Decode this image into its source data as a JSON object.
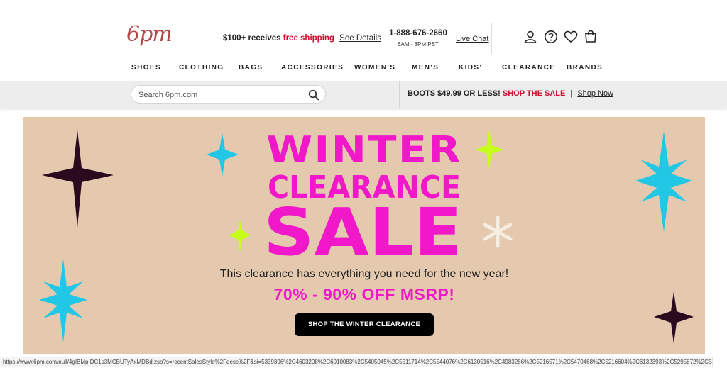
{
  "header": {
    "logo": "6pm",
    "promo": {
      "lead": "$100+ receives",
      "free": "free shipping",
      "details": "See Details"
    },
    "phone": "1-888-676-2660",
    "hours": "6AM - 8PM PST",
    "live_chat": "Live Chat",
    "icons": [
      "account-icon",
      "help-icon",
      "favorites-icon",
      "cart-icon"
    ]
  },
  "nav": {
    "items": [
      "SHOES",
      "CLOTHING",
      "BAGS",
      "ACCESSORIES",
      "WOMEN'S",
      "MEN'S",
      "KIDS'",
      "CLEARANCE",
      "BRANDS"
    ]
  },
  "search": {
    "placeholder": "Search 6pm.com",
    "value": ""
  },
  "promo_strip": {
    "lead": "BOOTS $49.99 OR LESS!",
    "sale": "SHOP THE SALE",
    "separator": "|",
    "link": "Shop Now"
  },
  "banner": {
    "headline": [
      "WINTER",
      "CLEARANCE",
      "SALE"
    ],
    "subtitle": "This clearance has everything you need for the new year!",
    "discount": "70% - 90% OFF MSRP!",
    "cta": "SHOP THE WINTER CLEARANCE",
    "colors": {
      "background": "#e5c9ae",
      "headline": "#f018c8",
      "cyan": "#22c7e6",
      "lime": "#c6ff1a",
      "dark": "#2b0a20",
      "cream": "#f6eee2"
    }
  },
  "status_url": "https://www.6pm.com/null/4gIBMpIDC1s3MCBUTyAxMDBd.zso?s=recentSalesStyle%2Fdesc%2F&si=5339396%2C4603208%2C6010083%2C5405045%2C5511714%2C5544076%2C6130516%2C4983286%2C5216571%2C5470468%2C5216604%2C6132393%2C5295872%2C5425..."
}
